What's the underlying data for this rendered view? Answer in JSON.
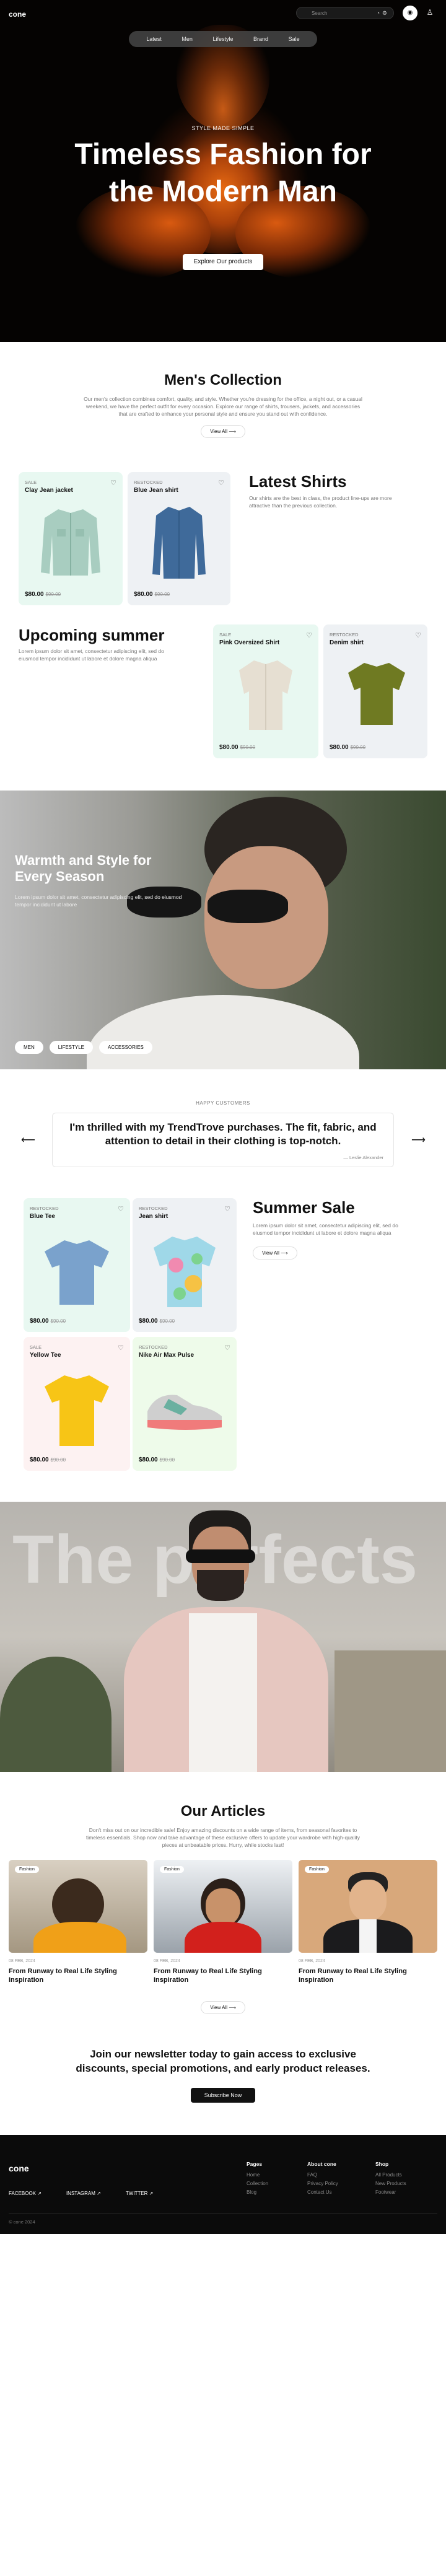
{
  "header": {
    "logo": "cone",
    "search_placeholder": "Search",
    "nav": [
      "Latest",
      "Men",
      "Lifestyle",
      "Brand",
      "Sale"
    ]
  },
  "hero": {
    "eyebrow": "STYLE MADE SIMPLE",
    "title_line1": "Timeless Fashion for",
    "title_line2": "the Modern Man",
    "cta": "Explore Our products"
  },
  "collection": {
    "title": "Men's Collection",
    "desc1": "Our men's collection combines comfort, quality, and style. Whether you're dressing for the office, a night out, or a casual",
    "desc2": "weekend, we have the perfect outfit for every occasion. Explore our range of shirts, trousers, jackets, and accessories",
    "desc3": "that are crafted to enhance your personal style and ensure you stand out with confidence.",
    "view_all": "View All"
  },
  "latest": {
    "title": "Latest Shirts",
    "desc1": "Our shirts are the best in class, the product line-ups are more",
    "desc2": "attractive than the previous collection.",
    "products": [
      {
        "tag": "SALE",
        "name": "Clay Jean jacket",
        "price": "$80.00",
        "old": "$90.00"
      },
      {
        "tag": "RESTOCKED",
        "name": "Blue Jean shirt",
        "price": "$80.00",
        "old": "$90.00"
      }
    ]
  },
  "upcoming": {
    "title": "Upcoming summer",
    "desc1": "Lorem ipsum dolor sit amet, consectetur adipiscing elit, sed do",
    "desc2": "eiusmod tempor incididunt ut labore et dolore magna aliqua",
    "products": [
      {
        "tag": "SALE",
        "name": "Pink Oversized Shirt",
        "price": "$80.00",
        "old": "$90.00"
      },
      {
        "tag": "RESTOCKED",
        "name": "Denim shirt",
        "price": "$80.00",
        "old": "$90.00"
      }
    ]
  },
  "warmth": {
    "title_line1": "Warmth and Style for",
    "title_line2": "Every Season",
    "desc1": "Lorem ipsum dolor sit amet, consectetur adipiscing elit, sed do eiusmod",
    "desc2": "tempor incididunt ut labore",
    "chips": [
      "MEN",
      "LIFESTYLE",
      "ACCESSORIES"
    ]
  },
  "testimonial": {
    "label": "HAPPY CUSTOMERS",
    "quote_line1": "I'm thrilled with my TrendTrove purchases. The fit, fabric, and",
    "quote_line2": "attention to detail in their clothing is top-notch.",
    "author": "— Leslie Alexander"
  },
  "summer": {
    "title": "Summer Sale",
    "desc1": "Lorem ipsum dolor sit amet, consectetur adipiscing elit, sed do",
    "desc2": "eiusmod tempor incididunt ut labore et dolore magna aliqua",
    "view_all": "View All",
    "products": [
      {
        "tag": "RESTOCKED",
        "name": "Blue Tee",
        "price": "$80.00",
        "old": "$90.00"
      },
      {
        "tag": "RESTOCKED",
        "name": "Jean shirt",
        "price": "$80.00",
        "old": "$90.00"
      },
      {
        "tag": "SALE",
        "name": "Yellow Tee",
        "price": "$80.00",
        "old": "$90.00"
      },
      {
        "tag": "RESTOCKED",
        "name": "Nike Air Max Pulse",
        "price": "$80.00",
        "old": "$90.00"
      }
    ]
  },
  "perfects": {
    "word": "The perfects"
  },
  "articles": {
    "title": "Our Articles",
    "desc1": "Don't miss out on our incredible sale! Enjoy amazing discounts on a wide range of items, from seasonal favorites to",
    "desc2": "timeless essentials. Shop now and take advantage of these exclusive offers to update your wardrobe with high-quality",
    "desc3": "pieces at unbeatable prices. Hurry, while stocks last!",
    "view_all": "View All",
    "items": [
      {
        "tag": "Fashion",
        "date": "08 FEB, 2024",
        "title1": "From Runway to Real Life Styling",
        "title2": "Inspiration"
      },
      {
        "tag": "Fashion",
        "date": "08 FEB, 2024",
        "title1": "From Runway to Real Life Styling",
        "title2": "Inspiration"
      },
      {
        "tag": "Fashion",
        "date": "08 FEB, 2024",
        "title1": "From Runway to Real Life Styling",
        "title2": "Inspiration"
      }
    ]
  },
  "newsletter": {
    "line1": "Join our newsletter today to gain access to exclusive",
    "line2": "discounts, special promotions, and early product releases.",
    "cta": "Subscribe Now"
  },
  "footer": {
    "logo": "cone",
    "socials": [
      "FACEBOOK",
      "INSTAGRAM",
      "TWITTER"
    ],
    "cols": [
      {
        "title": "Pages",
        "links": [
          "Home",
          "Collection",
          "Blog"
        ]
      },
      {
        "title": "About cone",
        "links": [
          "FAQ",
          "Privacy Policy",
          "Contact Us"
        ]
      },
      {
        "title": "Shop",
        "links": [
          "All Products",
          "New Products",
          "Footwear"
        ]
      }
    ],
    "copyright": "© cone 2024"
  },
  "colors": {
    "accent": "#111111",
    "mint": "#e8f8f1",
    "grey": "#eef1f4",
    "pink": "#fdf2f2",
    "green": "#eefbea"
  }
}
